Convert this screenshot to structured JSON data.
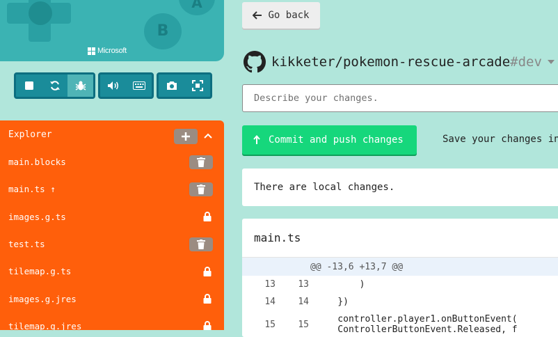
{
  "simulator": {
    "button_a_label": "A",
    "button_b_label": "B",
    "brand_label": "Microsoft"
  },
  "sim_toolbar": {
    "buttons": [
      {
        "icon": "stop-icon"
      },
      {
        "icon": "restart-icon"
      },
      {
        "icon": "debug-icon",
        "active": true
      },
      {
        "icon": "sound-icon"
      },
      {
        "icon": "keyboard-icon"
      },
      {
        "icon": "screenshot-icon"
      },
      {
        "icon": "fullscreen-icon"
      }
    ]
  },
  "explorer": {
    "title": "Explorer",
    "files": [
      {
        "name": "main.blocks",
        "action": "delete"
      },
      {
        "name": "main.ts ↑",
        "action": "delete"
      },
      {
        "name": "images.g.ts",
        "action": "locked"
      },
      {
        "name": "test.ts",
        "action": "delete"
      },
      {
        "name": "tilemap.g.ts",
        "action": "locked"
      },
      {
        "name": "images.g.jres",
        "action": "locked"
      },
      {
        "name": "tilemap.g.jres",
        "action": "locked"
      }
    ]
  },
  "github": {
    "go_back_label": "Go back",
    "repo_name": "kikketer/pokemon-rescue-arcade",
    "branch": "#dev",
    "description_placeholder": "Describe your changes.",
    "commit_label": "Commit and push changes",
    "save_hint": "Save your changes in",
    "local_changes_text": "There are local changes.",
    "diff": {
      "file": "main.ts",
      "hunk_header": "@@ -13,6 +13,7 @@",
      "lines": [
        {
          "old": "13",
          "new": "13",
          "code": "        )"
        },
        {
          "old": "14",
          "new": "14",
          "code": "    })"
        },
        {
          "old": "15",
          "new": "15",
          "code": "    controller.player1.onButtonEvent(",
          "code2": "    ControllerButtonEvent.Released, f"
        }
      ]
    }
  },
  "colors": {
    "background": "#b1e6db",
    "explorer": "#ff5f0b",
    "commit": "#16d77c",
    "simulator": "#3bb3b3"
  }
}
